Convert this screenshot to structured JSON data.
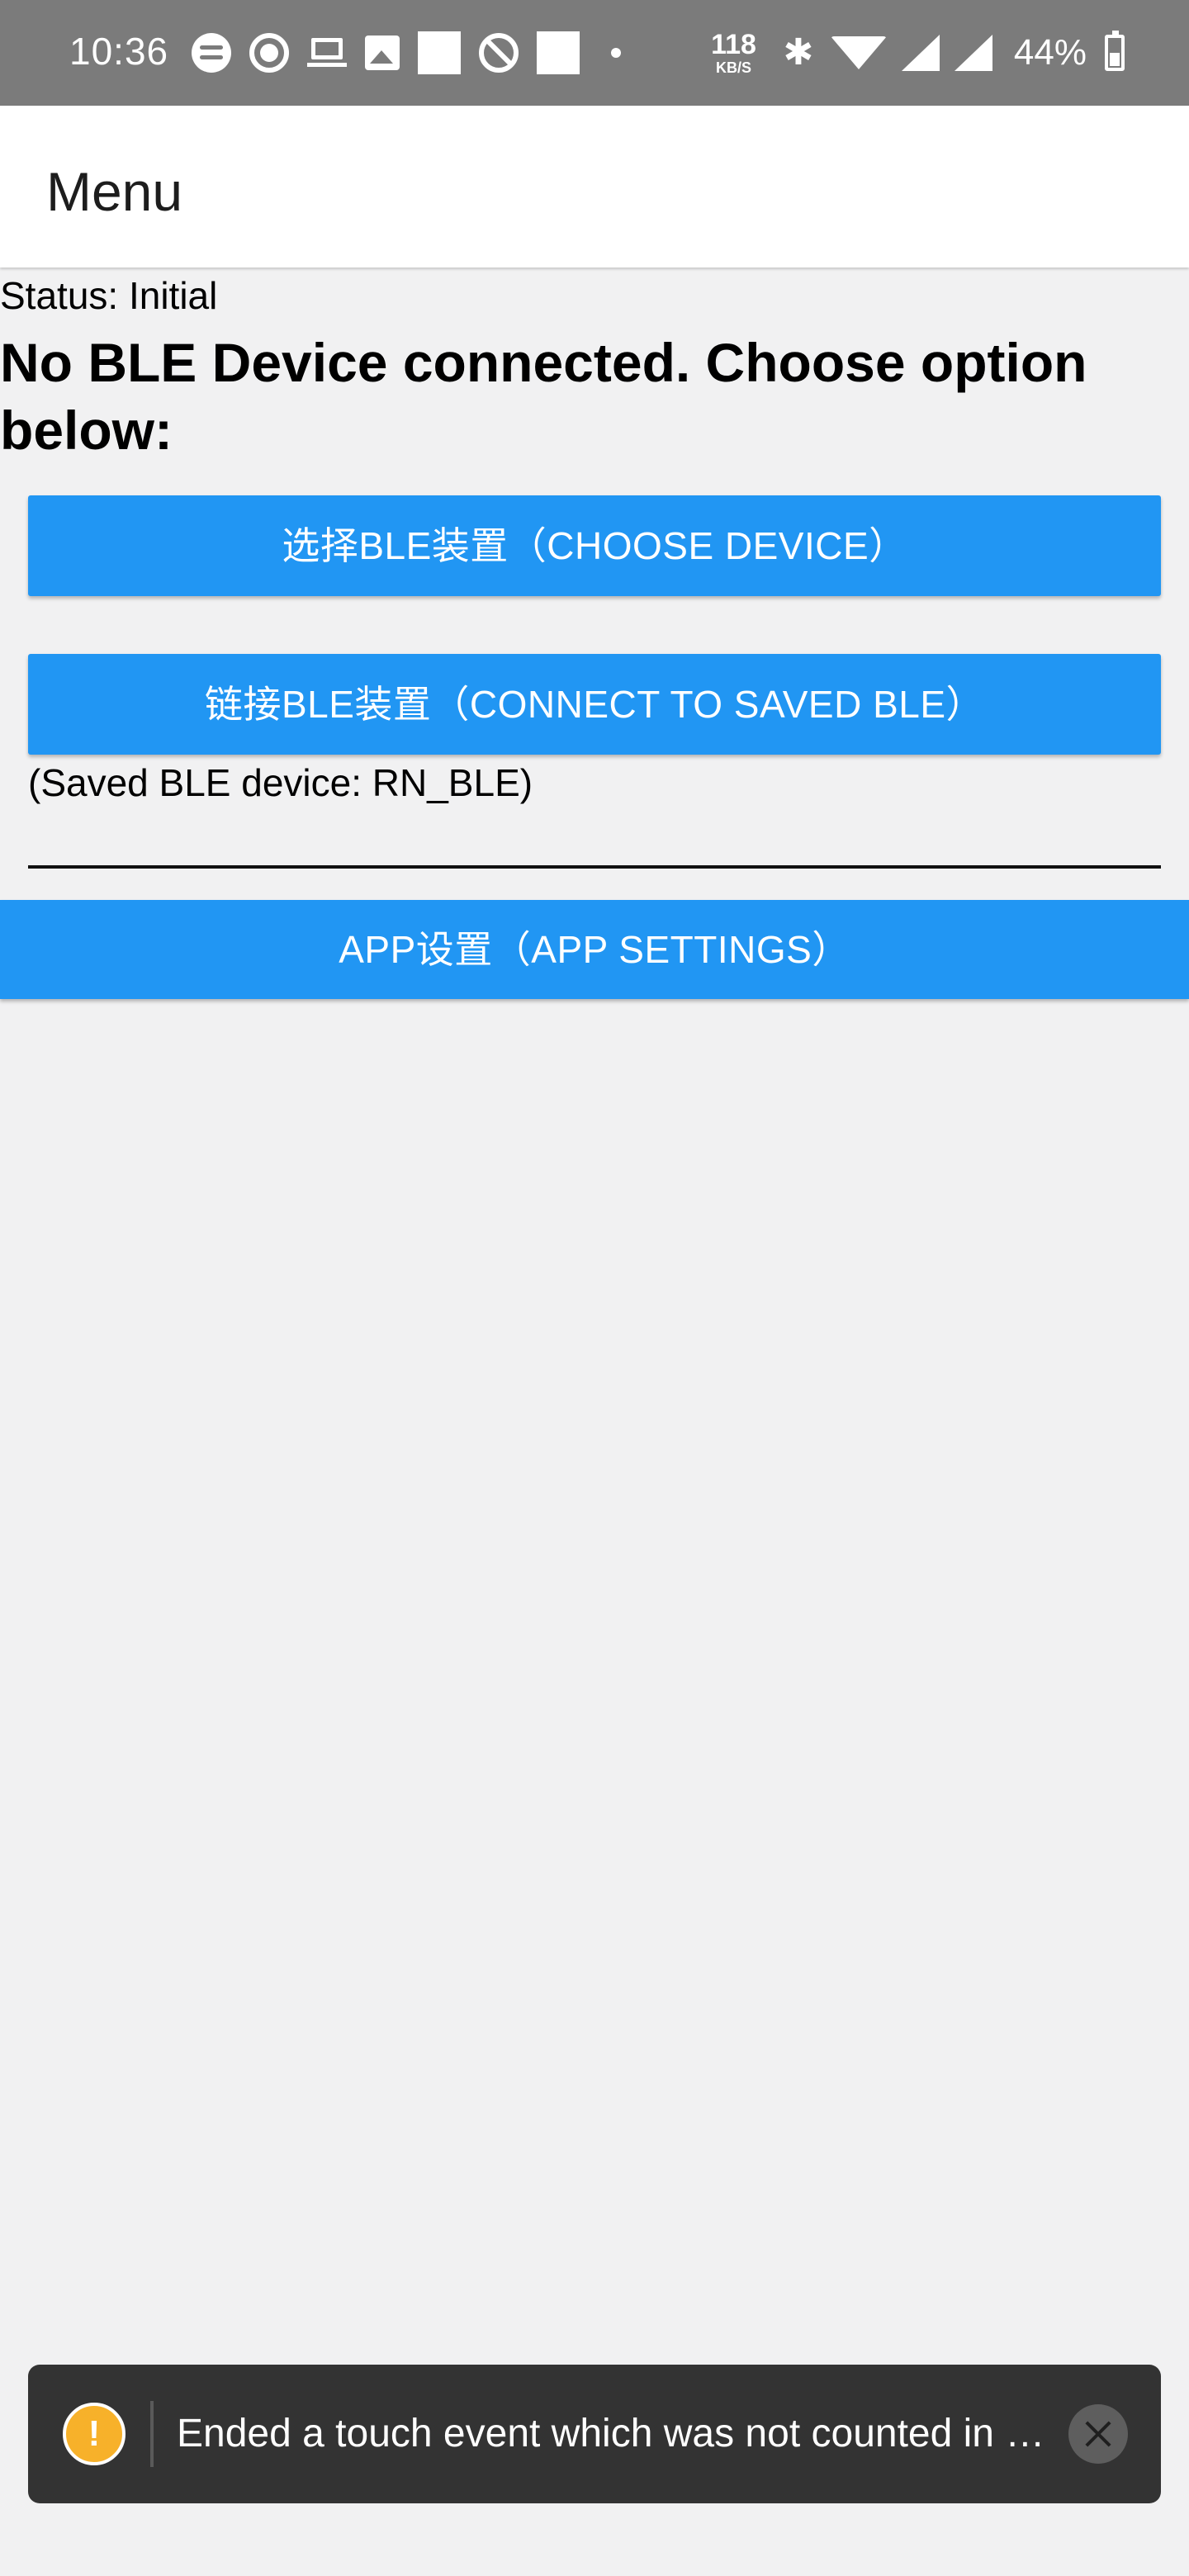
{
  "status_bar": {
    "time": "10:36",
    "net_speed_value": "118",
    "net_speed_unit": "KB/S",
    "battery_percent": "44%"
  },
  "header": {
    "title": "Menu"
  },
  "main": {
    "status": "Status: Initial",
    "prompt": "No BLE Device connected. Choose option below:",
    "choose_device_label": "选择BLE装置（CHOOSE DEVICE）",
    "connect_saved_label": "链接BLE装置（CONNECT TO SAVED BLE）",
    "saved_device_text": "(Saved BLE device: RN_BLE)",
    "app_settings_label": "APP设置（APP SETTINGS）"
  },
  "toast": {
    "icon_glyph": "!",
    "message": "Ended a touch event which was not counted in …"
  },
  "colors": {
    "primary_button": "#2196f3",
    "status_bar": "#7b7b7b",
    "toast_background": "#333333",
    "warning": "#f7b12a"
  }
}
